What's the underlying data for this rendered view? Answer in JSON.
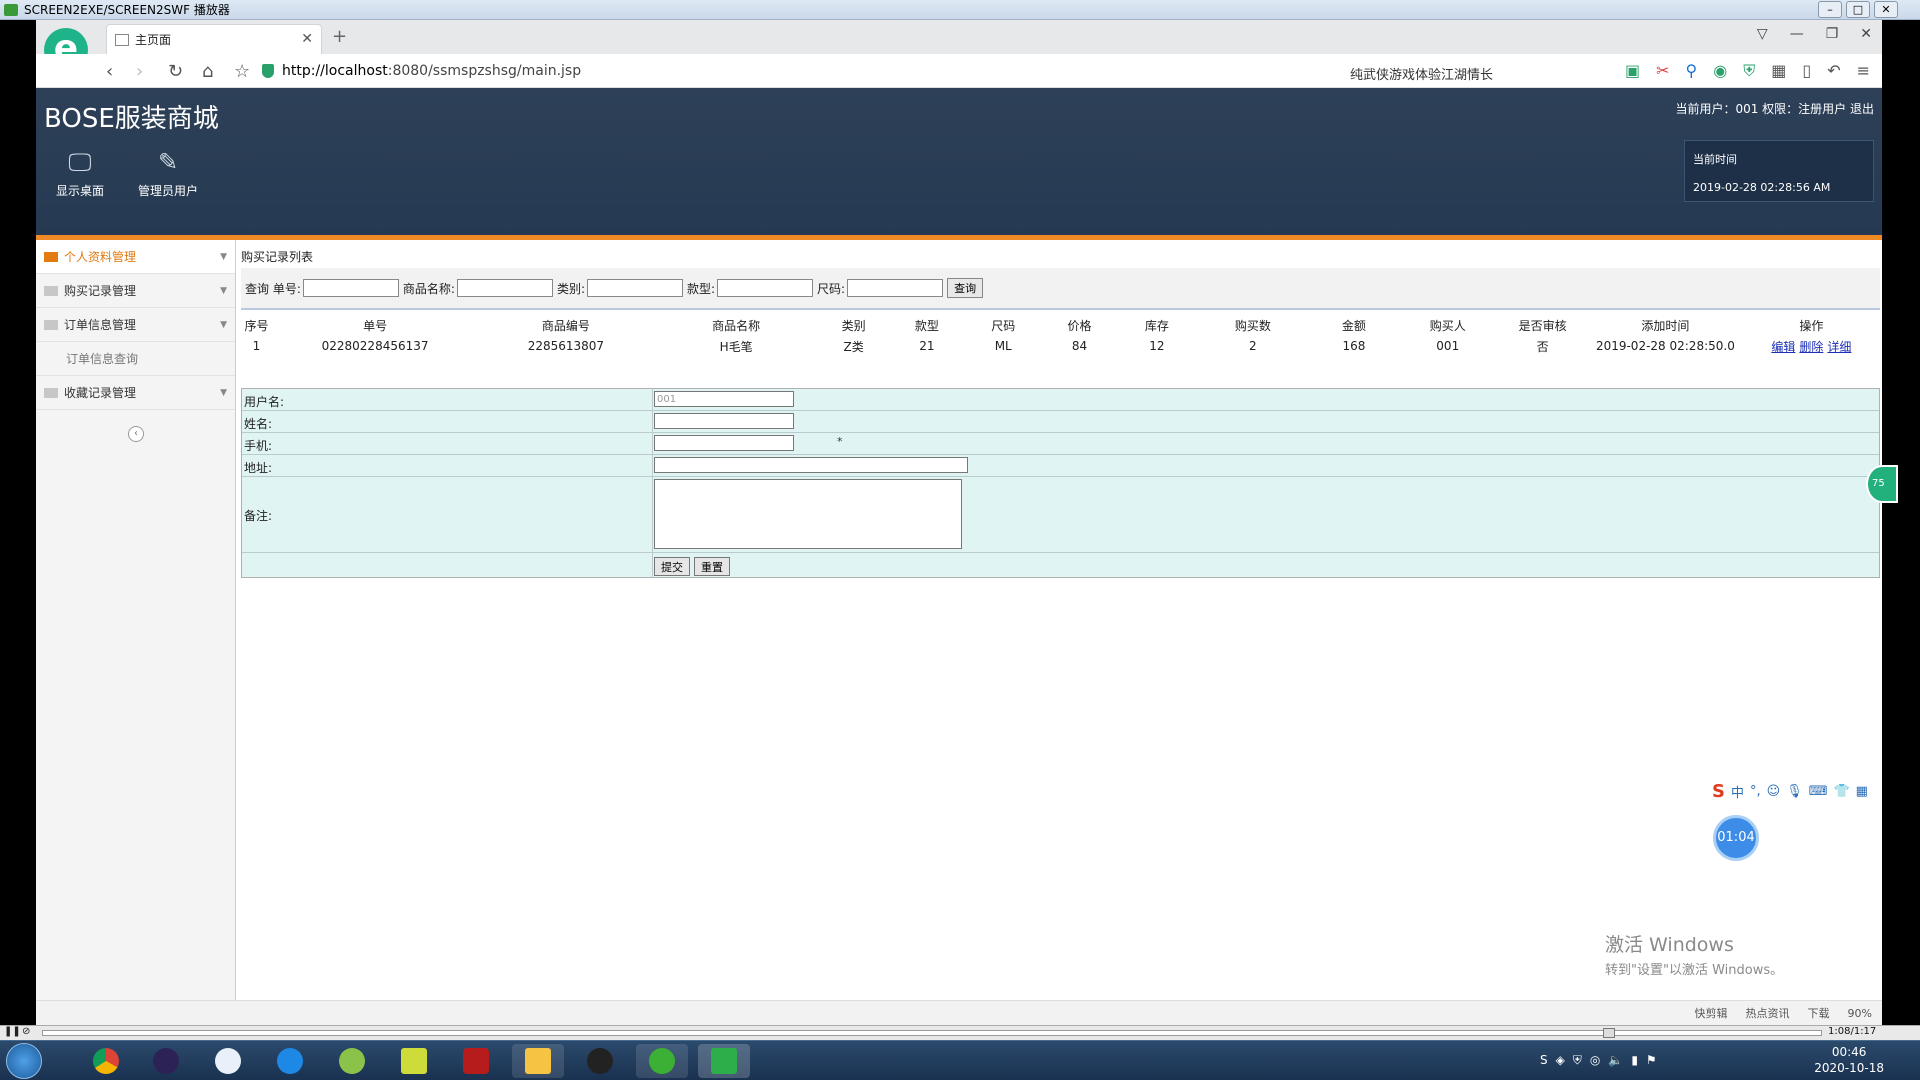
{
  "player": {
    "title": "SCREEN2EXE/SCREEN2SWF 播放器",
    "time": "1:08/1:17"
  },
  "browser": {
    "tab_title": "主页面",
    "url_host": "http://localhost",
    "url_rest": ":8080/ssmspzshsg/main.jsp",
    "search_text": "纯武侠游戏体验江湖情长",
    "status_items": [
      "快剪辑",
      "热点资讯",
      "下载",
      "90%"
    ]
  },
  "header": {
    "app_title": "BOSE服装商城",
    "user_info": "当前用户：001  权限：注册用户  退出",
    "nav": [
      {
        "label": "显示桌面",
        "icon": "monitor-icon"
      },
      {
        "label": "管理员用户",
        "icon": "pencil-icon"
      }
    ],
    "time_label": "当前时间",
    "time_value": "2019-02-28 02:28:56 AM"
  },
  "sidebar": {
    "items": [
      {
        "label": "个人资料管理"
      },
      {
        "label": "购买记录管理"
      },
      {
        "label": "订单信息管理"
      },
      {
        "label": "订单信息查询"
      },
      {
        "label": "收藏记录管理"
      }
    ]
  },
  "content": {
    "list_title": "购买记录列表",
    "query": {
      "prefix": "查询",
      "f1": "单号:",
      "f2": "商品名称:",
      "f3": "类别:",
      "f4": "款型:",
      "f5": "尺码:",
      "button": "查询"
    },
    "table": {
      "headers": [
        "序号",
        "单号",
        "商品编号",
        "商品名称",
        "类别",
        "款型",
        "尺码",
        "价格",
        "库存",
        "购买数",
        "金额",
        "购买人",
        "是否审核",
        "添加时间",
        "操作"
      ],
      "rows": [
        [
          "1",
          "02280228456137",
          "2285613807",
          "H毛笔",
          "Z类",
          "21",
          "ML",
          "84",
          "12",
          "2",
          "168",
          "001",
          "否",
          "2019-02-28 02:28:50.0"
        ]
      ],
      "ops": [
        "编辑",
        "删除",
        "详细"
      ]
    },
    "form": {
      "username_label": "用户名:",
      "username_value": "001",
      "name_label": "姓名:",
      "phone_label": "手机:",
      "phone_required": "*",
      "address_label": "地址:",
      "remark_label": "备注:",
      "submit": "提交",
      "reset": "重置"
    }
  },
  "overlay": {
    "watermark_title": "激活 Windows",
    "watermark_sub": "转到\"设置\"以激活 Windows。",
    "timer": "01:04",
    "ime": "中",
    "float_ball": "75"
  },
  "taskbar": {
    "clock_time": "00:46",
    "clock_date": "2020-10-18"
  }
}
